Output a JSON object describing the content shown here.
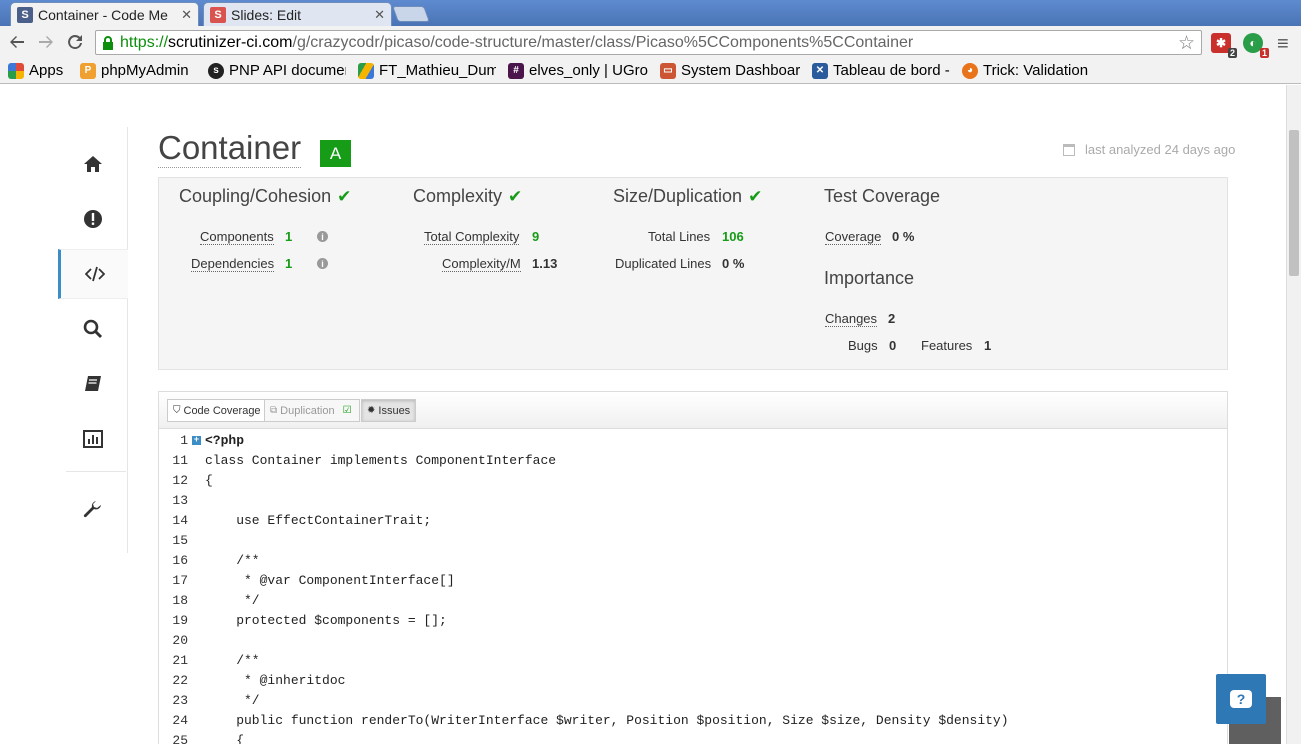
{
  "browser": {
    "tabs": [
      {
        "title": "Container - Code Me",
        "favicon": "S",
        "favicon_color": "#4a5f8a",
        "active": true
      },
      {
        "title": "Slides: Edit",
        "favicon": "S",
        "favicon_color": "#d9534f",
        "active": false
      }
    ],
    "close_glyph": "✕",
    "url": {
      "scheme": "https://",
      "host": "scrutinizer-ci.com",
      "path": "/g/crazycodr/picaso/code-structure/master/class/Picaso%5CComponents%5CContainer"
    },
    "extensions": [
      {
        "name": "red-extension-icon",
        "badge": "2",
        "color": "#c9302c"
      },
      {
        "name": "green-extension-icon",
        "badge": "1",
        "color": "#2a9d48"
      }
    ],
    "bookmarks": [
      {
        "label": "Apps",
        "icon": "apps-grid-icon",
        "color": "#e04a3b"
      },
      {
        "label": "phpMyAdmin",
        "icon": "phpmyadmin-icon",
        "color": "#f0a030"
      },
      {
        "label": "PNP API documer",
        "icon": "symfony-icon",
        "color": "#222222"
      },
      {
        "label": "FT_Mathieu_Dum",
        "icon": "google-drive-icon",
        "color": "#f4b400"
      },
      {
        "label": "elves_only | UGro",
        "icon": "slack-hash-icon",
        "color": "#4a154b"
      },
      {
        "label": "System Dashboar",
        "icon": "dashboard-icon",
        "color": "#cc5533"
      },
      {
        "label": "Tableau de bord -",
        "icon": "crossed-tools-icon",
        "color": "#2b5b9c"
      },
      {
        "label": "Trick: Validation",
        "icon": "fox-icon",
        "color": "#e8731a"
      }
    ]
  },
  "sidenav": {
    "items": [
      {
        "name": "home-icon"
      },
      {
        "name": "issues-icon"
      },
      {
        "name": "code-icon",
        "active": true
      },
      {
        "name": "search-icon"
      },
      {
        "name": "book-icon"
      },
      {
        "name": "chart-icon"
      },
      {
        "name": "wrench-icon"
      }
    ]
  },
  "header": {
    "title": "Container",
    "grade": "A",
    "analyzed": "last analyzed 24 days ago"
  },
  "metrics": {
    "coupling": {
      "heading": "Coupling/Cohesion",
      "rows": [
        {
          "label": "Components",
          "value": "1"
        },
        {
          "label": "Dependencies",
          "value": "1"
        }
      ]
    },
    "complexity": {
      "heading": "Complexity",
      "rows": [
        {
          "label": "Total Complexity",
          "value": "9"
        },
        {
          "label": "Complexity/M",
          "value": "1.13"
        }
      ]
    },
    "size": {
      "heading": "Size/Duplication",
      "rows": [
        {
          "label": "Total Lines",
          "value": "106"
        },
        {
          "label": "Duplicated Lines",
          "value": "0 %"
        }
      ]
    },
    "coverage": {
      "heading": "Test Coverage",
      "rows": [
        {
          "label": "Coverage",
          "value": "0 %"
        }
      ]
    },
    "importance": {
      "heading": "Importance",
      "rows": [
        {
          "label": "Changes",
          "value": "2"
        },
        {
          "label": "Bugs",
          "value": "0"
        },
        {
          "label": "Features",
          "value": "1"
        }
      ]
    },
    "check_glyph": "✔",
    "info_glyph": "i"
  },
  "code_tabs": [
    {
      "label": "Code Coverage",
      "icon": "shield-icon"
    },
    {
      "label": "Duplication",
      "icon": "copy-icon"
    },
    {
      "label": "Issues",
      "icon": "bug-icon"
    }
  ],
  "code_lines": [
    {
      "no": "1",
      "text": "<?php",
      "bold": true,
      "marker": "+"
    },
    {
      "no": "11",
      "text": "class Container implements ComponentInterface"
    },
    {
      "no": "12",
      "text": "{"
    },
    {
      "no": "13",
      "text": ""
    },
    {
      "no": "14",
      "text": "    use EffectContainerTrait;"
    },
    {
      "no": "15",
      "text": ""
    },
    {
      "no": "16",
      "text": "    /**"
    },
    {
      "no": "17",
      "text": "     * @var ComponentInterface[]"
    },
    {
      "no": "18",
      "text": "     */"
    },
    {
      "no": "19",
      "text": "    protected $components = [];"
    },
    {
      "no": "20",
      "text": ""
    },
    {
      "no": "21",
      "text": "    /**"
    },
    {
      "no": "22",
      "text": "     * @inheritdoc"
    },
    {
      "no": "23",
      "text": "     */"
    },
    {
      "no": "24",
      "text": "    public function renderTo(WriterInterface $writer, Position $position, Size $size, Density $density)"
    },
    {
      "no": "25",
      "text": "    {"
    }
  ],
  "help_glyph": "?",
  "to_top_glyph": "^"
}
